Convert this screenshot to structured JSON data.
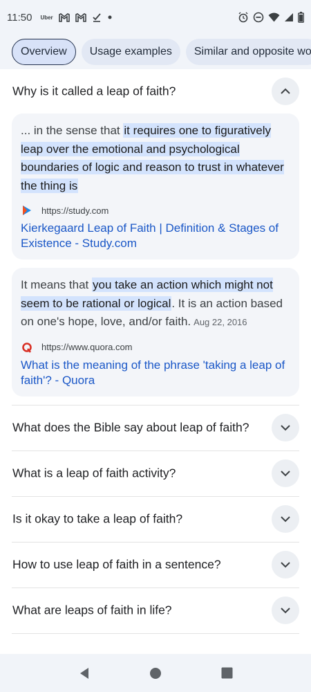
{
  "status_bar": {
    "time": "11:50",
    "left_icons": [
      "uber-icon",
      "gmail-icon",
      "gmail-icon",
      "check-icon",
      "dot-icon"
    ],
    "uber_text": "Uber",
    "right_icons": [
      "alarm-icon",
      "dnd-icon",
      "wifi-icon",
      "signal-icon",
      "battery-icon"
    ]
  },
  "chips": [
    {
      "label": "Overview",
      "active": true
    },
    {
      "label": "Usage examples",
      "active": false
    },
    {
      "label": "Similar and opposite wo",
      "active": false
    }
  ],
  "expanded_question": {
    "text": "Why is it called a leap of faith?",
    "icon": "chevron-up-icon"
  },
  "answers": [
    {
      "prefix": "... in the sense that ",
      "highlight": "it requires one to figuratively leap over the emotional and psychological boundaries of logic and reason to trust in whatever the thing is",
      "suffix": "",
      "date": "",
      "source_url": "https://study.com",
      "source_icon": "study-favicon",
      "link": "Kierkegaard Leap of Faith | Definition & Stages of Existence - Study.com"
    },
    {
      "prefix": "It means that ",
      "highlight": "you take an action which might not seem to be rational or logical",
      "suffix": ". It is an action based on one's hope, love, and/or faith.",
      "date": "Aug 22, 2016",
      "source_url": "https://www.quora.com",
      "source_icon": "quora-favicon",
      "link": "What is the meaning of the phrase 'taking a leap of faith'? - Quora"
    }
  ],
  "questions": [
    {
      "text": "What does the Bible say about leap of faith?",
      "icon": "chevron-down-icon"
    },
    {
      "text": "What is a leap of faith activity?",
      "icon": "chevron-down-icon"
    },
    {
      "text": "Is it okay to take a leap of faith?",
      "icon": "chevron-down-icon"
    },
    {
      "text": "How to use leap of faith in a sentence?",
      "icon": "chevron-down-icon"
    },
    {
      "text": "What are leaps of faith in life?",
      "icon": "chevron-down-icon"
    }
  ],
  "nav_bar": [
    "back-icon",
    "home-icon",
    "recents-icon"
  ],
  "colors": {
    "link": "#1a57c7",
    "highlight": "#d3e3fd",
    "card_bg": "#f3f5f9",
    "bar_bg": "#f1f4f9"
  }
}
